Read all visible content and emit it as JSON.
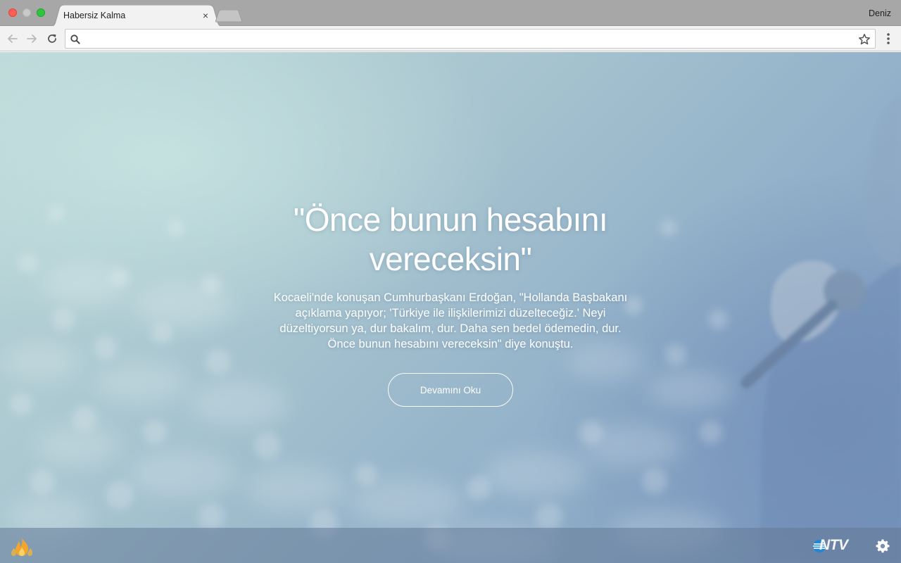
{
  "browser": {
    "tab_title": "Habersiz Kalma",
    "tab_close_icon": "close-icon",
    "profile_name": "Deniz",
    "omnibox": {
      "value": "",
      "placeholder": ""
    }
  },
  "article": {
    "headline": "\"Önce bunun hesabını vereceksin\"",
    "summary": "Kocaeli'nde konuşan Cumhurbaşkanı Erdoğan, \"Hollanda Başbakanı açıklama yapıyor; 'Türkiye ile ilişkilerimizi düzelteceğiz.' Neyi düzeltiyorsun ya, dur bakalım, dur. Daha sen bedel ödemedin, dur. Önce bunun hesabını vereceksin\" diye konuştu.",
    "read_more_label": "Devamını Oku"
  },
  "footer": {
    "source_logo_text": "NTV",
    "left_logo": "flame-logo-icon",
    "settings_icon": "gear-icon"
  },
  "colors": {
    "accent_white": "#ffffff",
    "ntv_blue": "#1e88d6",
    "flame_orange": "#f3a52c"
  }
}
